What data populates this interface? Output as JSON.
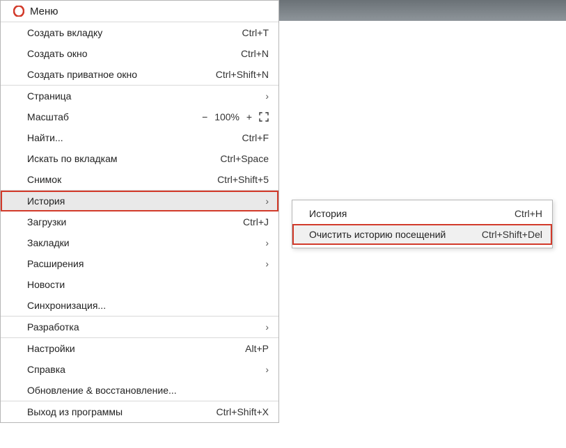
{
  "header": {
    "title": "Меню"
  },
  "menu": {
    "create_tab": {
      "label": "Создать вкладку",
      "shortcut": "Ctrl+T"
    },
    "create_window": {
      "label": "Создать окно",
      "shortcut": "Ctrl+N"
    },
    "create_private": {
      "label": "Создать приватное окно",
      "shortcut": "Ctrl+Shift+N"
    },
    "page": {
      "label": "Страница"
    },
    "zoom": {
      "label": "Масштаб",
      "minus": "−",
      "value": "100%",
      "plus": "+"
    },
    "find": {
      "label": "Найти...",
      "shortcut": "Ctrl+F"
    },
    "tab_search": {
      "label": "Искать по вкладкам",
      "shortcut": "Ctrl+Space"
    },
    "snapshot": {
      "label": "Снимок",
      "shortcut": "Ctrl+Shift+5"
    },
    "history": {
      "label": "История"
    },
    "downloads": {
      "label": "Загрузки",
      "shortcut": "Ctrl+J"
    },
    "bookmarks": {
      "label": "Закладки"
    },
    "extensions": {
      "label": "Расширения"
    },
    "news": {
      "label": "Новости"
    },
    "sync": {
      "label": "Синхронизация..."
    },
    "dev": {
      "label": "Разработка"
    },
    "settings": {
      "label": "Настройки",
      "shortcut": "Alt+P"
    },
    "help": {
      "label": "Справка"
    },
    "update": {
      "label": "Обновление & восстановление..."
    },
    "exit": {
      "label": "Выход из программы",
      "shortcut": "Ctrl+Shift+X"
    }
  },
  "submenu": {
    "history": {
      "label": "История",
      "shortcut": "Ctrl+H"
    },
    "clear_history": {
      "label": "Очистить историю посещений",
      "shortcut": "Ctrl+Shift+Del"
    }
  },
  "glyphs": {
    "chevron": "›"
  }
}
